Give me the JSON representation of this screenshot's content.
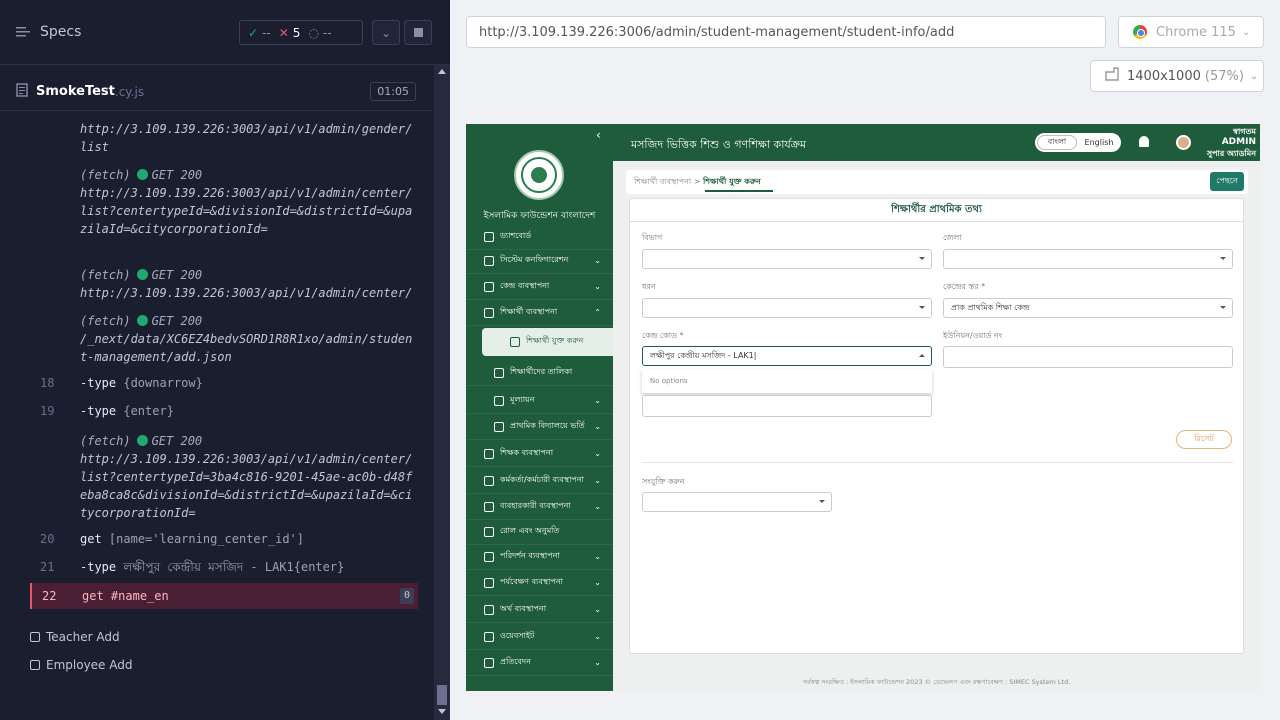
{
  "runner": {
    "specs_label": "Specs",
    "stats": {
      "passed": "--",
      "failed": "5",
      "pending": "--"
    },
    "spec": {
      "name": "SmokeTest",
      "ext": ".cy.js",
      "duration": "01:05"
    },
    "commands": [
      {
        "num": "",
        "text": "http://3.109.139.226:3003/api/v1/admin/gender/list"
      },
      {
        "num": "",
        "method": "(fetch)",
        "status": "GET 200",
        "text": "http://3.109.139.226:3003/api/v1/admin/center/list?centertypeId=&divisionId=&districtId=&upazilaId=&citycorporationId="
      },
      {
        "num": "",
        "method": "(fetch)",
        "status": "GET 200",
        "text": "http://3.109.139.226:3003/api/v1/admin/center/"
      },
      {
        "num": "",
        "method": "(fetch)",
        "status": "GET 200",
        "text": "/_next/data/XC6EZ4bedvSORD1R8R1xo/admin/student-management/add.json"
      },
      {
        "num": "18",
        "kw": "-type",
        "arg": "{downarrow}"
      },
      {
        "num": "19",
        "kw": "-type",
        "arg": "{enter}"
      },
      {
        "num": "",
        "method": "(fetch)",
        "status": "GET 200",
        "text": "http://3.109.139.226:3003/api/v1/admin/center/list?centertypeId=3ba4c816-9201-45ae-ac0b-d48feba8ca8c&divisionId=&districtId=&upazilaId=&citycorporationId="
      },
      {
        "num": "20",
        "kw": "get",
        "arg": "[name='learning_center_id']"
      },
      {
        "num": "21",
        "kw": "-type",
        "arg": "লক্ষীপুর কেন্দ্রীয় মসজিদ - LAK1{enter}"
      },
      {
        "num": "22",
        "kw": "get",
        "arg": "#name_en",
        "badge": "0"
      }
    ],
    "suites": [
      "Teacher Add",
      "Employee Add"
    ]
  },
  "browser": {
    "url": "http://3.109.139.226:3006/admin/student-management/student-info/add",
    "browser_name": "Chrome 115",
    "viewport": "1400x1000",
    "zoom": "(57%)"
  },
  "app": {
    "org_name": "ইসলামিক ফাউন্ডেশন বাংলাদেশ",
    "title": "মসজিদ ভিত্তিক শিশু ও গণশিক্ষা কার্যক্রম",
    "lang_bn": "বাংলা",
    "lang_en": "English",
    "user": {
      "line1": "স্বাগতম",
      "line2": "ADMIN",
      "line3": "সুপার অ্যাডমিন"
    },
    "menu": [
      {
        "label": "ড্যাশবোর্ড",
        "chev": ""
      },
      {
        "label": "সিস্টেম কনফিগারেশন",
        "chev": "⌄"
      },
      {
        "label": "কেন্দ্র ব্যবস্থাপনা",
        "chev": "⌄"
      },
      {
        "label": "শিক্ষার্থী ব্যবস্থাপনা",
        "chev": "⌃"
      },
      {
        "label": "শিক্ষার্থী যুক্ত করুন",
        "chev": "",
        "sub": true,
        "selected": true
      },
      {
        "label": "শিক্ষার্থীদের তালিকা",
        "chev": "",
        "sub": true
      },
      {
        "label": "মূল্যায়ন",
        "chev": "⌄",
        "sub": true
      },
      {
        "label": "প্রাথমিক বিদ্যালয়ে ভর্তি",
        "chev": "⌄",
        "sub": true
      },
      {
        "label": "শিক্ষক ব্যবস্থাপনা",
        "chev": "⌄"
      },
      {
        "label": "কর্মকর্তা/কর্মচারী ব্যবস্থাপনা",
        "chev": "⌄"
      },
      {
        "label": "ব্যবহারকারী ব্যবস্থাপনা",
        "chev": "⌄"
      },
      {
        "label": "রোল এবং অনুমতি",
        "chev": ""
      },
      {
        "label": "পরিদর্শন ব্যবস্থাপনা",
        "chev": "⌄"
      },
      {
        "label": "পর্যবেক্ষণ ব্যবস্থাপনা",
        "chev": "⌄"
      },
      {
        "label": "অর্থ ব্যবস্থাপনা",
        "chev": "⌄"
      },
      {
        "label": "ওয়েবসাইট",
        "chev": "⌄"
      },
      {
        "label": "প্রতিবেদন",
        "chev": "⌄"
      }
    ],
    "breadcrumb": {
      "parent": "শিক্ষার্থী ব্যবস্থাপনা",
      "sep": ">",
      "current": "শিক্ষার্থী যুক্ত করুন"
    },
    "back_label": "পেছনে",
    "card_title": "শিক্ষার্থীর প্রাথমিক তথ্য",
    "fields": {
      "division_label": "বিভাগ",
      "district_label": "জেলা",
      "type_label": "ধরন",
      "center_level_label": "কেন্দ্রের স্তর *",
      "center_level_value": "প্রাক প্রাথমিক শিক্ষা কেন্দ্র",
      "center_code_label": "কেন্দ্র কোড *",
      "center_code_value": "লক্ষীপুর কেন্দ্রীয় মসজিদ - LAK1|",
      "union_label": "ইউনিয়ন/ওয়ার্ড নং",
      "no_options": "No options",
      "attach_label": "সংযুক্তি করুন"
    },
    "reset_label": "রিসেট",
    "footer": "সর্বস্বত্ব সংরক্ষিত : ইসলামিক ফাউন্ডেশন 2023 © ডেভেলপ এবং রক্ষণাবেক্ষণ : SIMEC System Ltd."
  }
}
